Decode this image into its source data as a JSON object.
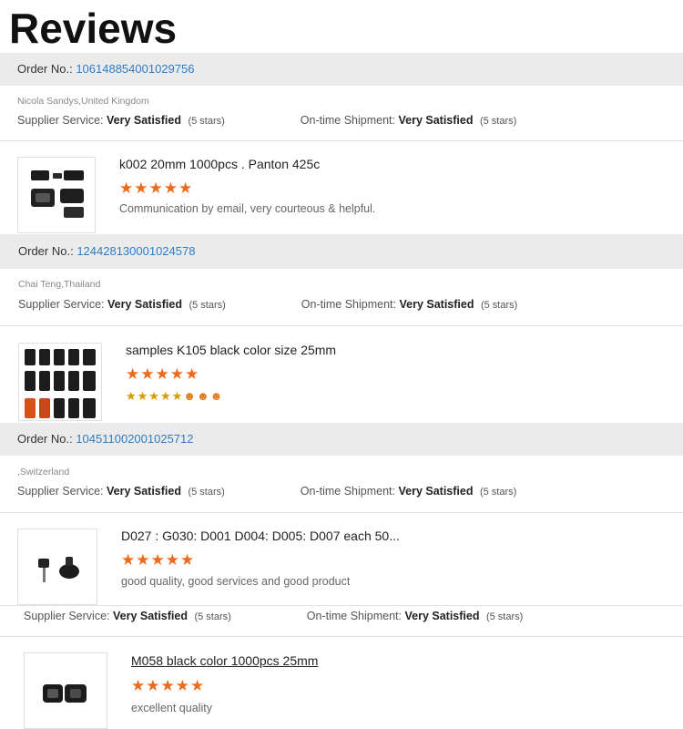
{
  "header": {
    "title": "Reviews"
  },
  "reviews": [
    {
      "order_label": "Order No.:",
      "order_number": "106148854001029756",
      "buyer": "Nicola Sandys,United Kingdom",
      "supplier_label": "Supplier Service:",
      "supplier_value": "Very Satisfied",
      "supplier_stars_note": "(5 stars)",
      "shipment_label": "On-time Shipment:",
      "shipment_value": "Very Satisfied",
      "shipment_stars_note": "(5 stars)",
      "product": "k002 20mm 1000pcs . Panton 425c",
      "stars": "★★★★★",
      "rating": 5,
      "comment": "Communication by email, very courteous & helpful."
    },
    {
      "order_label": "Order No.:",
      "order_number": "124428130001024578",
      "buyer": "Chai Teng,Thailand",
      "supplier_label": "Supplier Service:",
      "supplier_value": "Very Satisfied",
      "supplier_stars_note": "(5 stars)",
      "shipment_label": "On-time Shipment:",
      "shipment_value": "Very Satisfied",
      "shipment_stars_note": "(5 stars)",
      "product": "samples K105 black color size 25mm",
      "stars": "★★★★★",
      "rating": 5,
      "comment_stars": "★★★★★",
      "comment_faces": "☻☻☻"
    },
    {
      "order_label": "Order No.:",
      "order_number": "104511002001025712",
      "buyer": ",Switzerland",
      "supplier_label": "Supplier Service:",
      "supplier_value": "Very Satisfied",
      "supplier_stars_note": "(5 stars)",
      "shipment_label": "On-time Shipment:",
      "shipment_value": "Very Satisfied",
      "shipment_stars_note": "(5 stars)",
      "product": "D027 : G030: D001 D004: D005: D007 each 50...",
      "stars": "★★★★★",
      "rating": 5,
      "comment": "good quality, good services and good product"
    },
    {
      "supplier_label": "Supplier Service:",
      "supplier_value": "Very Satisfied",
      "supplier_stars_note": "(5 stars)",
      "shipment_label": "On-time Shipment:",
      "shipment_value": "Very Satisfied",
      "shipment_stars_note": "(5 stars)",
      "product": "M058 black color 1000pcs 25mm",
      "stars": "★★★★★",
      "rating": 5,
      "comment": "excellent quality"
    }
  ]
}
